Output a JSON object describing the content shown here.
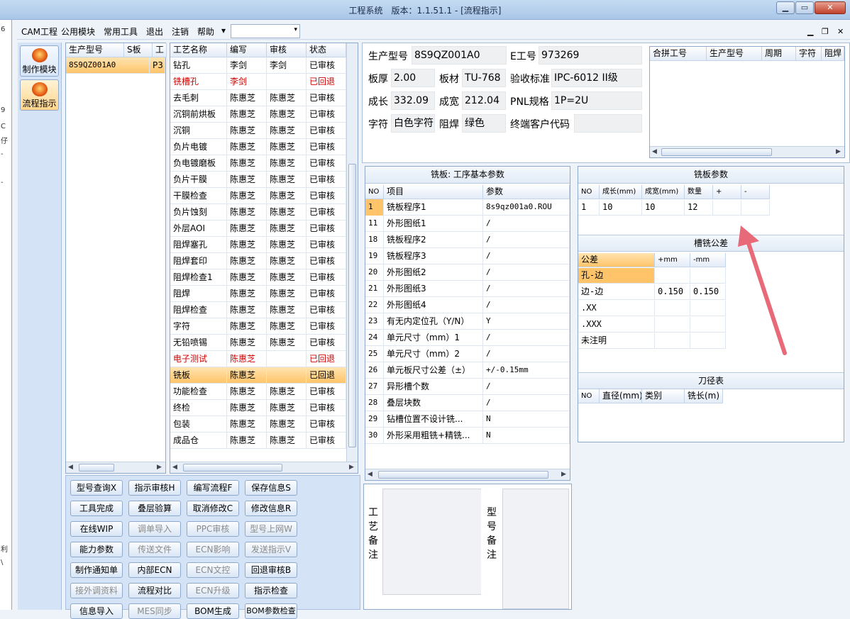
{
  "window": {
    "title": "工程系统　版本：1.1.51.1 - [流程指示]",
    "min": "▁",
    "max": "▭",
    "close": "✕"
  },
  "left_strip": [
    "6",
    "9",
    "C",
    "仔",
    "-",
    "-",
    "利",
    "\\"
  ],
  "menu": {
    "items": [
      "CAM工程",
      "公用模块",
      "常用工具",
      "退出",
      "注销",
      "帮助"
    ],
    "dropdown_arrow": "▾",
    "combo_value": "",
    "mdi_min": "▁",
    "mdi_restore": "❐",
    "mdi_close": "✕"
  },
  "nav": {
    "buttons": [
      "制作模块",
      "流程指示"
    ]
  },
  "product_grid": {
    "headers": [
      "生产型号",
      "S板",
      "工"
    ],
    "rows": [
      [
        "8S9QZ001A0",
        "",
        "P3"
      ]
    ]
  },
  "process_grid": {
    "headers": [
      "工艺名称",
      "编写",
      "审核",
      "状态"
    ],
    "rows": [
      {
        "name": "钻孔",
        "writer": "李剑",
        "reviewer": "李剑",
        "status": "已审核",
        "red": false,
        "sel": false
      },
      {
        "name": "铣槽孔",
        "writer": "李剑",
        "reviewer": "",
        "status": "已回退",
        "red": true,
        "sel": false
      },
      {
        "name": "去毛刺",
        "writer": "陈惠芝",
        "reviewer": "陈惠芝",
        "status": "已审核",
        "red": false,
        "sel": false
      },
      {
        "name": "沉铜前烘板",
        "writer": "陈惠芝",
        "reviewer": "陈惠芝",
        "status": "已审核",
        "red": false,
        "sel": false
      },
      {
        "name": "沉铜",
        "writer": "陈惠芝",
        "reviewer": "陈惠芝",
        "status": "已审核",
        "red": false,
        "sel": false
      },
      {
        "name": "负片电镀",
        "writer": "陈惠芝",
        "reviewer": "陈惠芝",
        "status": "已审核",
        "red": false,
        "sel": false
      },
      {
        "name": "负电镀磨板",
        "writer": "陈惠芝",
        "reviewer": "陈惠芝",
        "status": "已审核",
        "red": false,
        "sel": false
      },
      {
        "name": "负片干膜",
        "writer": "陈惠芝",
        "reviewer": "陈惠芝",
        "status": "已审核",
        "red": false,
        "sel": false
      },
      {
        "name": "干膜检查",
        "writer": "陈惠芝",
        "reviewer": "陈惠芝",
        "status": "已审核",
        "red": false,
        "sel": false
      },
      {
        "name": "负片蚀刻",
        "writer": "陈惠芝",
        "reviewer": "陈惠芝",
        "status": "已审核",
        "red": false,
        "sel": false
      },
      {
        "name": "外层AOI",
        "writer": "陈惠芝",
        "reviewer": "陈惠芝",
        "status": "已审核",
        "red": false,
        "sel": false
      },
      {
        "name": "阻焊塞孔",
        "writer": "陈惠芝",
        "reviewer": "陈惠芝",
        "status": "已审核",
        "red": false,
        "sel": false
      },
      {
        "name": "阻焊套印",
        "writer": "陈惠芝",
        "reviewer": "陈惠芝",
        "status": "已审核",
        "red": false,
        "sel": false
      },
      {
        "name": "阻焊检查1",
        "writer": "陈惠芝",
        "reviewer": "陈惠芝",
        "status": "已审核",
        "red": false,
        "sel": false
      },
      {
        "name": "阻焊",
        "writer": "陈惠芝",
        "reviewer": "陈惠芝",
        "status": "已审核",
        "red": false,
        "sel": false
      },
      {
        "name": "阻焊检查",
        "writer": "陈惠芝",
        "reviewer": "陈惠芝",
        "status": "已审核",
        "red": false,
        "sel": false
      },
      {
        "name": "字符",
        "writer": "陈惠芝",
        "reviewer": "陈惠芝",
        "status": "已审核",
        "red": false,
        "sel": false
      },
      {
        "name": "无铅喷锡",
        "writer": "陈惠芝",
        "reviewer": "陈惠芝",
        "status": "已审核",
        "red": false,
        "sel": false
      },
      {
        "name": "电子测试",
        "writer": "陈惠芝",
        "reviewer": "",
        "status": "已回退",
        "red": true,
        "sel": false
      },
      {
        "name": "铣板",
        "writer": "陈惠芝",
        "reviewer": "",
        "status": "已回退",
        "red": false,
        "sel": true
      },
      {
        "name": "功能检查",
        "writer": "陈惠芝",
        "reviewer": "陈惠芝",
        "status": "已审核",
        "red": false,
        "sel": false
      },
      {
        "name": "终检",
        "writer": "陈惠芝",
        "reviewer": "陈惠芝",
        "status": "已审核",
        "red": false,
        "sel": false
      },
      {
        "name": "包装",
        "writer": "陈惠芝",
        "reviewer": "陈惠芝",
        "status": "已审核",
        "red": false,
        "sel": false
      },
      {
        "name": "成品仓",
        "writer": "陈惠芝",
        "reviewer": "陈惠芝",
        "status": "已审核",
        "red": false,
        "sel": false
      }
    ]
  },
  "buttons": [
    [
      {
        "l": "型号查询X",
        "d": false
      },
      {
        "l": "指示审核H",
        "d": false
      },
      {
        "l": "编写流程F",
        "d": false
      },
      {
        "l": "保存信息S",
        "d": false
      }
    ],
    [
      {
        "l": "工具完成",
        "d": false
      },
      {
        "l": "叠层验算",
        "d": false
      },
      {
        "l": "取消修改C",
        "d": false
      },
      {
        "l": "修改信息R",
        "d": false
      }
    ],
    [
      {
        "l": "在线WIP",
        "d": false
      },
      {
        "l": "调单导入",
        "d": true
      },
      {
        "l": "PPC审核",
        "d": true
      },
      {
        "l": "型号上网W",
        "d": true
      }
    ],
    [
      {
        "l": "能力参数",
        "d": false
      },
      {
        "l": "传送文件",
        "d": true
      },
      {
        "l": "ECN影响",
        "d": true
      },
      {
        "l": "发送指示V",
        "d": true
      }
    ],
    [
      {
        "l": "制作通知单",
        "d": false
      },
      {
        "l": "内部ECN",
        "d": false
      },
      {
        "l": "ECN文控",
        "d": true
      },
      {
        "l": "回退审核B",
        "d": false
      }
    ],
    [
      {
        "l": "接外调资料",
        "d": true
      },
      {
        "l": "流程对比",
        "d": false
      },
      {
        "l": "ECN升级",
        "d": true
      },
      {
        "l": "指示检查",
        "d": false
      }
    ],
    [
      {
        "l": "信息导入",
        "d": false
      },
      {
        "l": "MES同步",
        "d": true
      },
      {
        "l": "BOM生成",
        "d": false
      },
      {
        "l": "BOM参数检查",
        "d": false
      }
    ]
  ],
  "info": {
    "product_label": "生产型号",
    "product": "8S9QZ001A0",
    "e_label": "E工号",
    "e": "973269",
    "thick_label": "板厚",
    "thick": "2.00",
    "material_label": "板材",
    "material": "TU-768",
    "std_label": "验收标准",
    "std": "IPC-6012 II级",
    "len_label": "成长",
    "len": "332.09",
    "wid_label": "成宽",
    "wid": "212.04",
    "pnl_label": "PNL规格",
    "pnl": "1P=2U",
    "char_label": "字符",
    "char": "白色字符",
    "mask_label": "阻焊",
    "mask": "绿色",
    "cust_label": "终端客户代码",
    "cust": ""
  },
  "merge_grid": {
    "headers": [
      "合拼工号",
      "生产型号",
      "周期",
      "字符",
      "阻焊"
    ]
  },
  "milling_params": {
    "title": "铣板: 工序基本参数",
    "headers": [
      "NO",
      "项目",
      "参数"
    ],
    "rows": [
      [
        "1",
        "铣板程序1",
        "8s9qz001a0.ROU"
      ],
      [
        "11",
        "外形图纸1",
        "/"
      ],
      [
        "18",
        "铣板程序2",
        "/"
      ],
      [
        "19",
        "铣板程序3",
        "/"
      ],
      [
        "20",
        "外形图纸2",
        "/"
      ],
      [
        "21",
        "外形图纸3",
        "/"
      ],
      [
        "22",
        "外形图纸4",
        "/"
      ],
      [
        "23",
        "有无内定位孔（Y/N）",
        "Y"
      ],
      [
        "24",
        "单元尺寸（mm）1",
        "/"
      ],
      [
        "25",
        "单元尺寸（mm）2",
        "/"
      ],
      [
        "26",
        "单元板尺寸公差（±）",
        "+/-0.15mm"
      ],
      [
        "27",
        "异形槽个数",
        "/"
      ],
      [
        "28",
        "叠层块数",
        "/"
      ],
      [
        "29",
        "钻槽位置不设计铣...",
        "N"
      ],
      [
        "30",
        "外形采用粗铣+精铣...",
        "N"
      ]
    ]
  },
  "board_params": {
    "title": "铣板参数",
    "headers": [
      "NO",
      "成长(mm)",
      "成宽(mm)",
      "数量",
      "+",
      "-"
    ],
    "rows": [
      [
        "1",
        "10",
        "10",
        "12",
        "",
        ""
      ]
    ]
  },
  "slot_tol": {
    "title": "槽铣公差",
    "headers": [
      "公差",
      "+mm",
      "-mm"
    ],
    "rows": [
      [
        "孔-边",
        "",
        ""
      ],
      [
        "边-边",
        "0.150",
        "0.150"
      ],
      [
        ".XX",
        "",
        ""
      ],
      [
        ".XXX",
        "",
        ""
      ],
      [
        "未注明",
        "",
        ""
      ]
    ]
  },
  "cutter": {
    "title": "刀径表",
    "headers": [
      "NO",
      "直径(mm)",
      "类别",
      "铣长(m)"
    ]
  },
  "remarks": {
    "process_label": "工艺备注",
    "model_label": "型号备注"
  },
  "colors": {
    "selected": "#ffc46a",
    "returned": "#d20000",
    "arrow": "#e86a78"
  }
}
